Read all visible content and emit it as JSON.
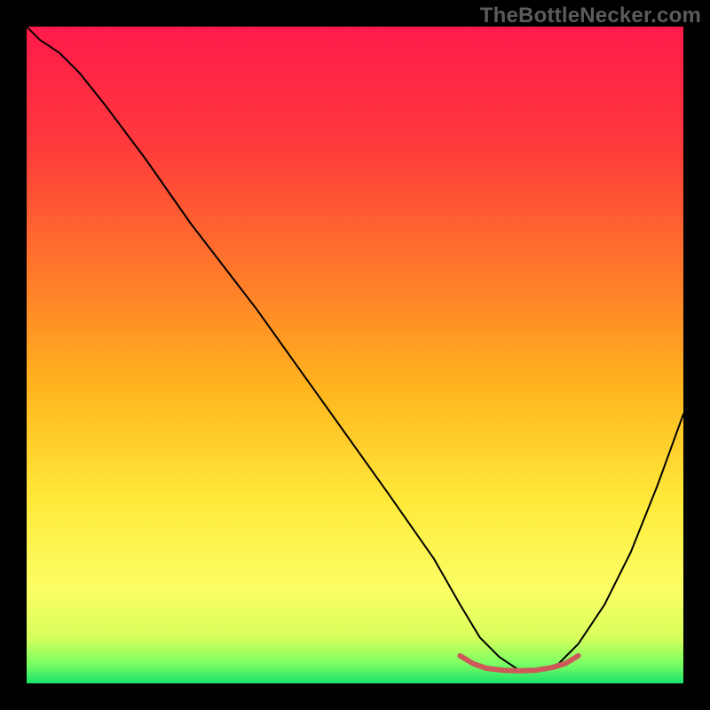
{
  "watermark": "TheBottleNecker.com",
  "chart_data": {
    "type": "line",
    "title": "",
    "xlabel": "",
    "ylabel": "",
    "xlim": [
      0,
      100
    ],
    "ylim": [
      0,
      100
    ],
    "grid": false,
    "legend": false,
    "background_gradient": {
      "stops": [
        {
          "offset": 0.0,
          "color": "#ff1a4b"
        },
        {
          "offset": 0.18,
          "color": "#ff3a3c"
        },
        {
          "offset": 0.38,
          "color": "#ff7a2a"
        },
        {
          "offset": 0.55,
          "color": "#ffb51e"
        },
        {
          "offset": 0.72,
          "color": "#ffe93a"
        },
        {
          "offset": 0.86,
          "color": "#fbff66"
        },
        {
          "offset": 0.93,
          "color": "#d7ff5b"
        },
        {
          "offset": 0.97,
          "color": "#7bff62"
        },
        {
          "offset": 1.0,
          "color": "#19e26b"
        }
      ]
    },
    "series": [
      {
        "name": "bottleneck-curve",
        "color": "#000000",
        "width": 2,
        "x": [
          0,
          2,
          5,
          8,
          12,
          18,
          25,
          35,
          45,
          55,
          62,
          66,
          69,
          72,
          75,
          78,
          81,
          84,
          88,
          92,
          96,
          100
        ],
        "y": [
          100,
          98,
          96,
          93,
          88,
          80,
          70,
          57,
          43,
          29,
          19,
          12,
          7,
          4,
          2,
          2,
          3,
          6,
          12,
          20,
          30,
          41
        ]
      },
      {
        "name": "optimum-band",
        "color": "#cc5a5a",
        "width": 6,
        "x": [
          66,
          68,
          70,
          72.5,
          75,
          77.5,
          80,
          82,
          84
        ],
        "y": [
          4.2,
          3.0,
          2.3,
          2.0,
          1.9,
          2.0,
          2.4,
          3.0,
          4.2
        ]
      }
    ]
  }
}
